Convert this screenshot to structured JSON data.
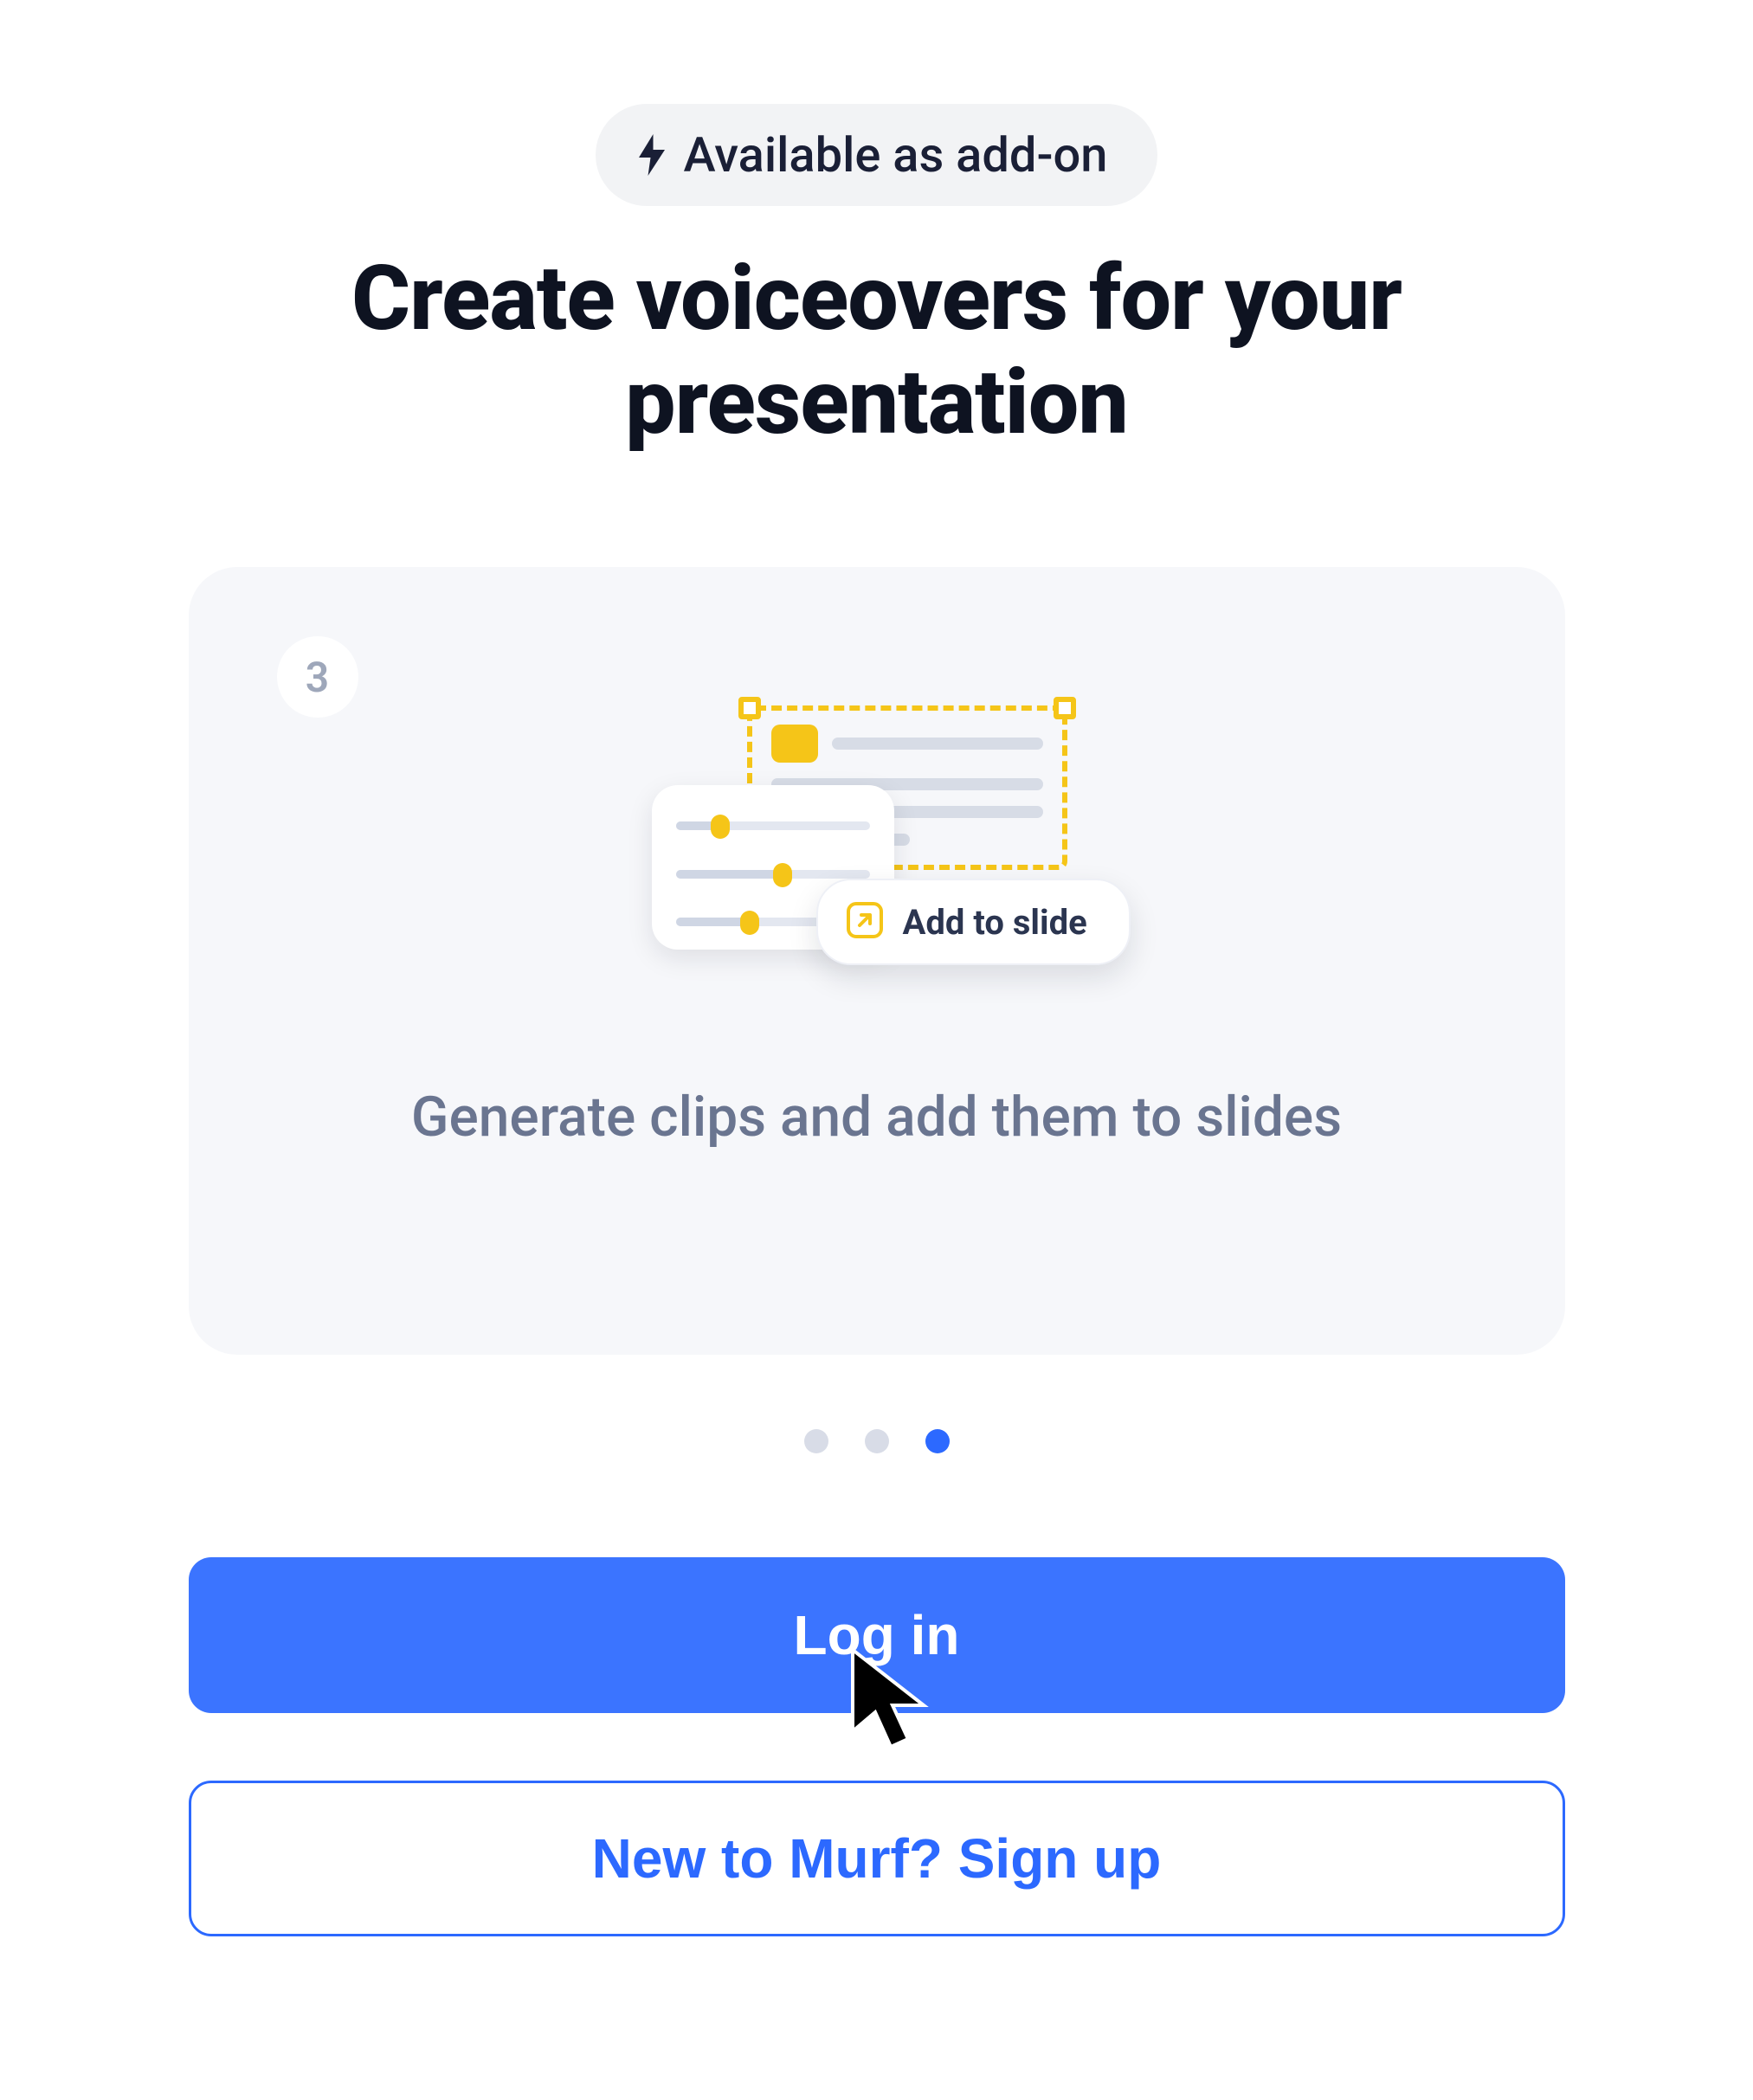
{
  "badge": {
    "label": "Available as add-on"
  },
  "title": "Create voiceovers for your presentation",
  "card": {
    "step_number": "3",
    "chip_label": "Add to slide",
    "caption": "Generate clips and add them to slides"
  },
  "pagination": {
    "total": 3,
    "active_index": 2
  },
  "actions": {
    "login_label": "Log in",
    "signup_label": "New to Murf? Sign up"
  }
}
